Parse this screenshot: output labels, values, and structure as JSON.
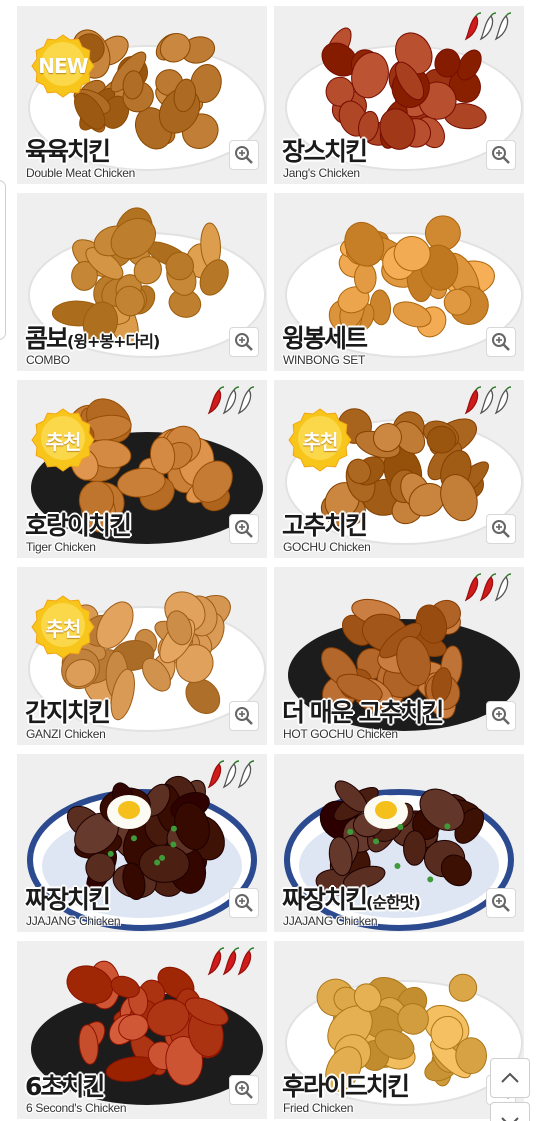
{
  "menu": [
    {
      "ko": "육육치킨",
      "ko_sub": "",
      "en": "Double Meat Chicken",
      "badge": "NEW",
      "spice": 0,
      "plate": "white",
      "food": "#b8752e"
    },
    {
      "ko": "장스치킨",
      "ko_sub": "",
      "en": "Jang's Chicken",
      "badge": "",
      "spice": 1,
      "plate": "white",
      "food": "#a33a1a"
    },
    {
      "ko": "콤보",
      "ko_sub": "(윙+봉+다리)",
      "en": "COMBO",
      "badge": "",
      "spice": 0,
      "plate": "white",
      "food": "#c98a3a"
    },
    {
      "ko": "윙봉세트",
      "ko_sub": "",
      "en": "WINBONG SET",
      "badge": "",
      "spice": 0,
      "plate": "white",
      "food": "#d9923a"
    },
    {
      "ko": "호랑이치킨",
      "ko_sub": "",
      "en": "Tiger Chicken",
      "badge": "추천",
      "spice": 1,
      "plate": "black",
      "food": "#c47a32"
    },
    {
      "ko": "고추치킨",
      "ko_sub": "",
      "en": "GOCHU Chicken",
      "badge": "추천",
      "spice": 1,
      "plate": "white",
      "food": "#b36e28"
    },
    {
      "ko": "간지치킨",
      "ko_sub": "",
      "en": "GANZI Chicken",
      "badge": "추천",
      "spice": 0,
      "plate": "white",
      "food": "#c98a45"
    },
    {
      "ko": "더 매운 고추치킨",
      "ko_sub": "",
      "en": "HOT GOCHU Chicken",
      "badge": "",
      "spice": 2,
      "plate": "black",
      "food": "#b5692c"
    },
    {
      "ko": "짜장치킨",
      "ko_sub": "",
      "en": "JJAJANG Chicken",
      "badge": "",
      "spice": 1,
      "plate": "bowl",
      "food": "#4a1e10"
    },
    {
      "ko": "짜장치킨",
      "ko_sub": "(순한맛)",
      "en": "JJAJANG Chicken",
      "badge": "",
      "spice": 0,
      "plate": "bowl",
      "food": "#4a1e10"
    },
    {
      "ko": "6초치킨",
      "ko_sub": "",
      "en": "6 Second's Chicken",
      "badge": "",
      "spice": 3,
      "plate": "black",
      "food": "#b8401e"
    },
    {
      "ko": "후라이드치킨",
      "ko_sub": "",
      "en": "Fried Chicken",
      "badge": "",
      "spice": 0,
      "plate": "white",
      "food": "#d9a445"
    }
  ],
  "icons": {
    "zoom": "zoom-in-icon",
    "pepper": "chili-pepper-icon",
    "scroll_up": "chevron-up-icon",
    "scroll_down": "chevron-down-icon"
  },
  "colors": {
    "card_bg": "#efefef",
    "pepper_red": "#d11a1a",
    "badge_yellow": "#f8c51a"
  }
}
